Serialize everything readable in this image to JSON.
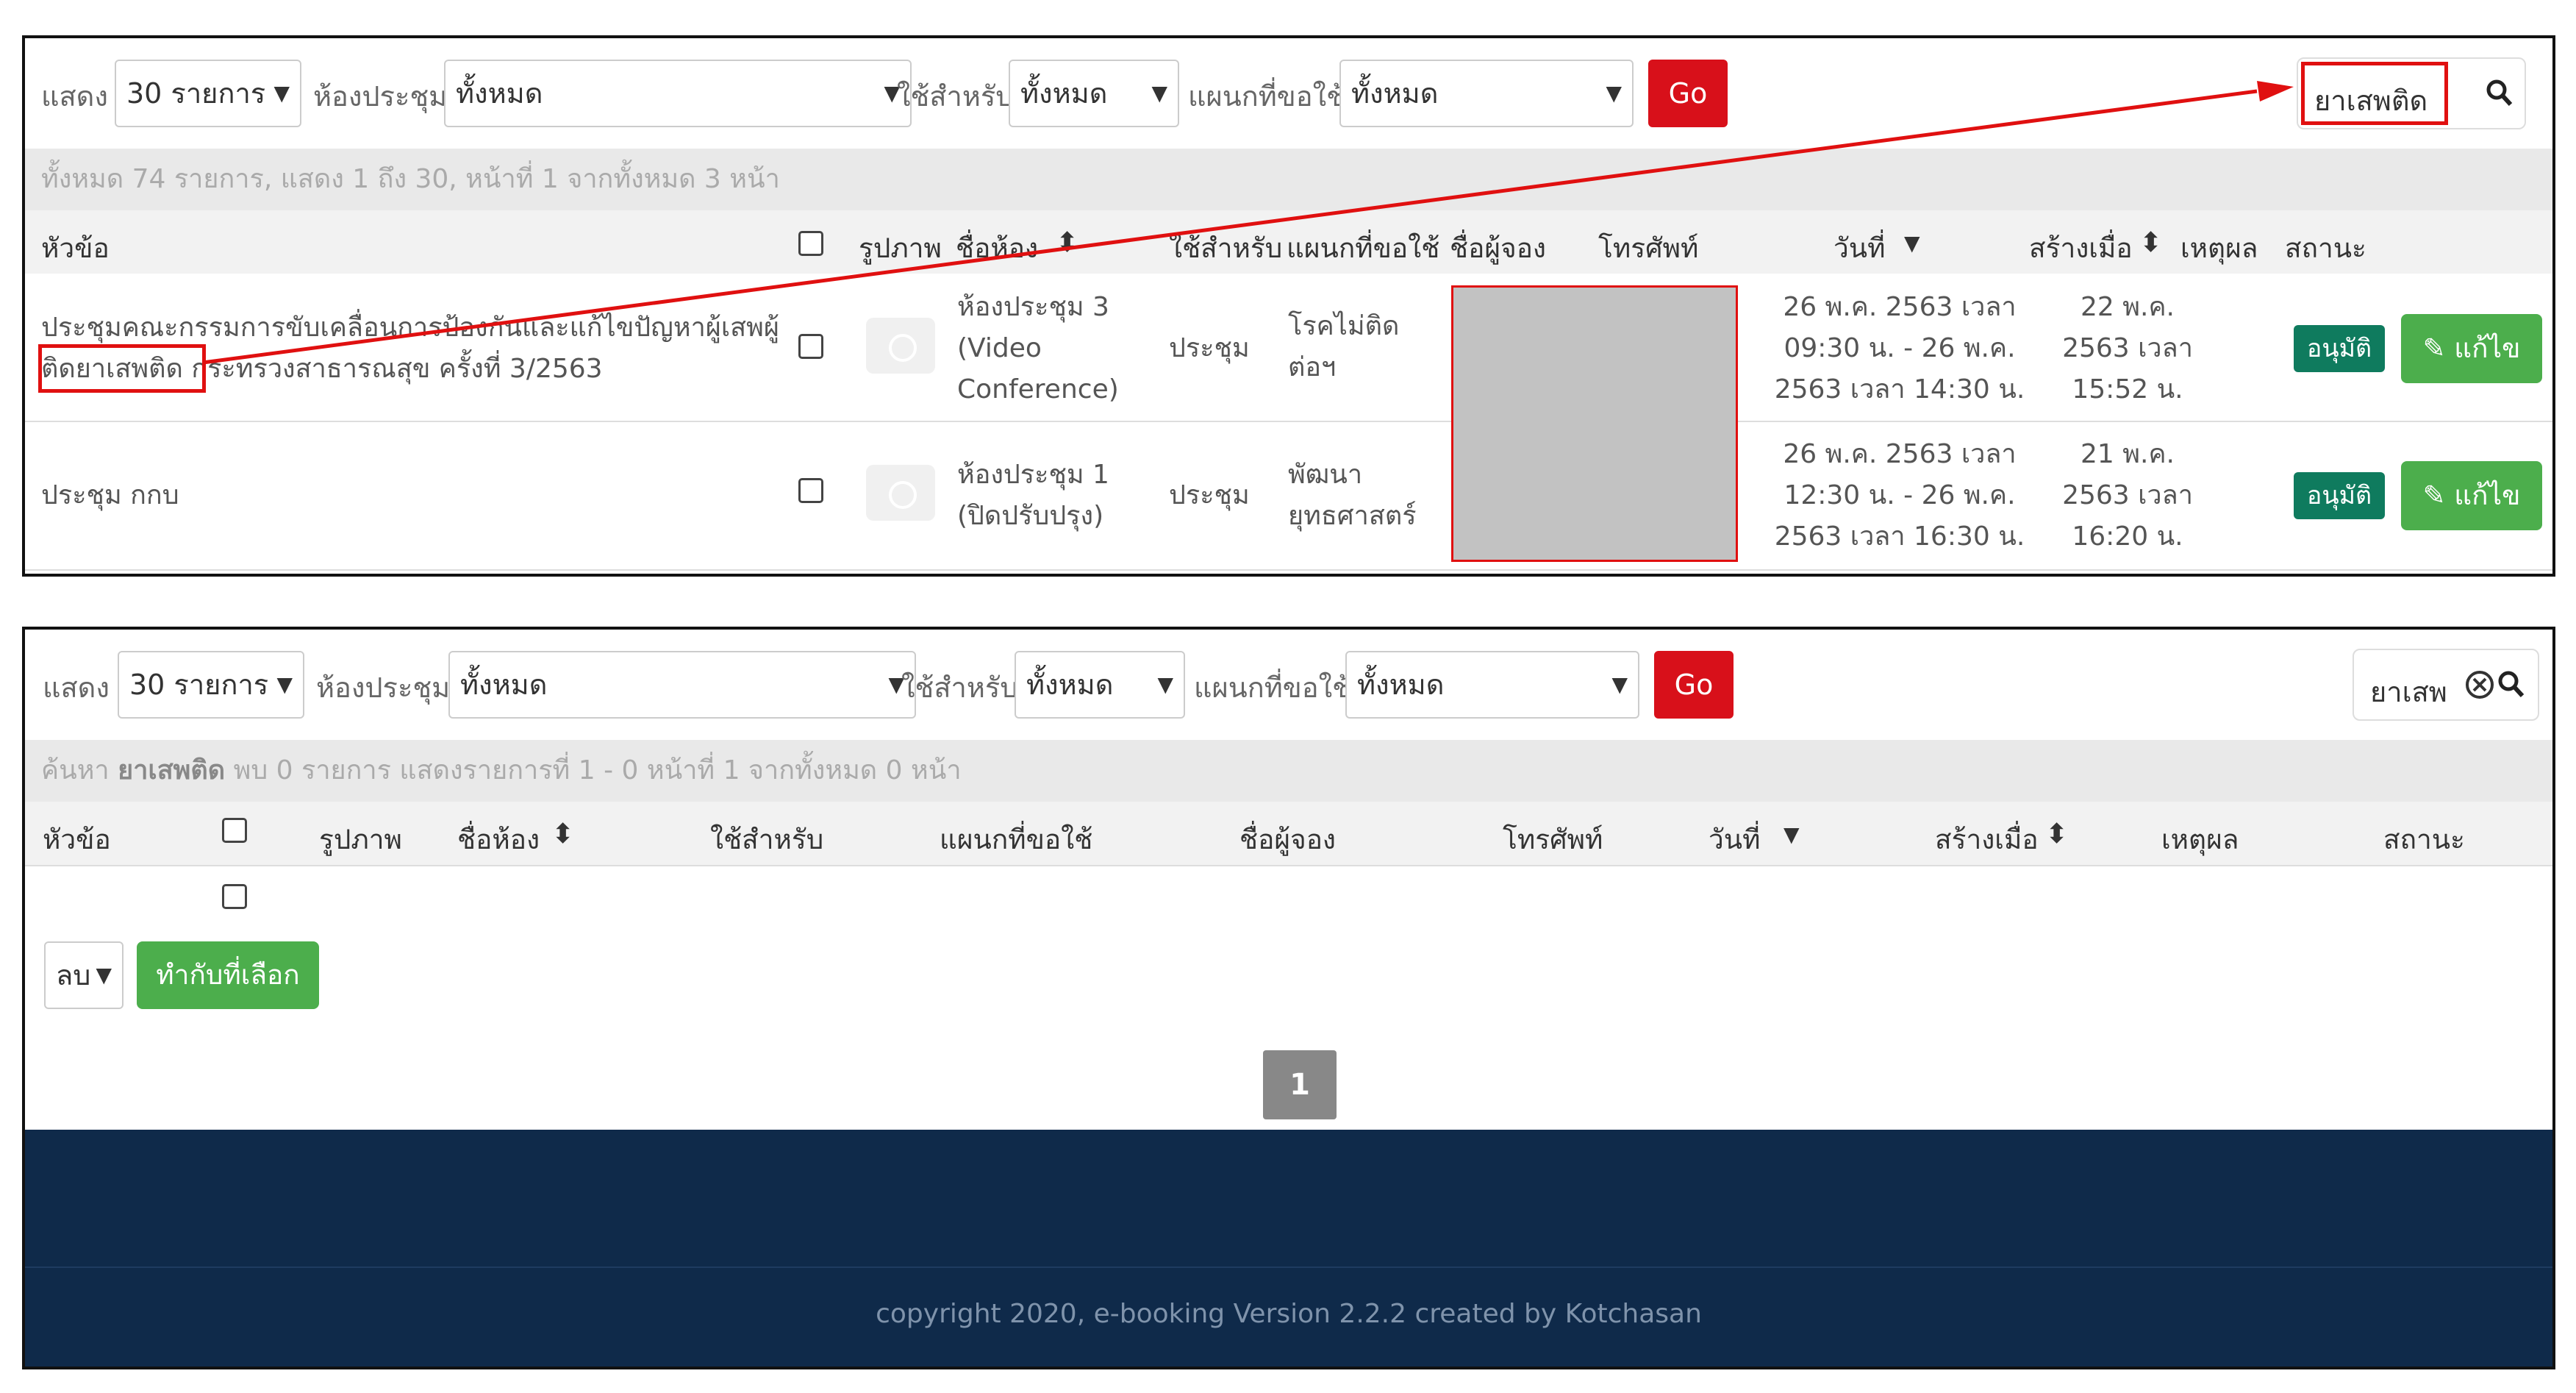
{
  "top_panel": {
    "toolbar": {
      "show_label": "แสดง",
      "show_value": "30 รายการ",
      "room_label": "ห้องประชุม",
      "room_value": "ทั้งหมด",
      "use_label": "ใช้สำหรับ",
      "use_value": "ทั้งหมด",
      "dept_label": "แผนกที่ขอใช้",
      "dept_value": "ทั้งหมด",
      "go_label": "Go",
      "search_value": "ยาเสพติด"
    },
    "info": "ทั้งหมด 74 รายการ, แสดง 1 ถึง 30, หน้าที่ 1 จากทั้งหมด 3 หน้า",
    "headers": {
      "topic": "หัวข้อ",
      "image": "รูปภาพ",
      "room": "ชื่อห้อง",
      "use": "ใช้สำหรับ",
      "dept": "แผนกที่ขอใช้",
      "booker": "ชื่อผู้จอง",
      "phone": "โทรศัพท์",
      "date": "วันที่",
      "created": "สร้างเมื่อ",
      "reason": "เหตุผล",
      "status": "สถานะ"
    },
    "rows": [
      {
        "topic_line1": "ประชุมคณะกรรมการขับเคลื่อนการป้องกันและแก้ไขปัญหาผู้เสพผู้",
        "topic_line2_highlight": "ติดยาเสพติด",
        "topic_line2_rest": " กระทรวงสาธารณสุข ครั้งที่ 3/2563",
        "room_line1": "ห้องประชุม 3",
        "room_line2": "(Video",
        "room_line3": "Conference)",
        "use": "ประชุม",
        "dept_line1": "โรคไม่ติด",
        "dept_line2": "ต่อฯ",
        "date_line1": "26 พ.ค. 2563 เวลา",
        "date_line2": "09:30 น. - 26 พ.ค.",
        "date_line3": "2563 เวลา 14:30 น.",
        "created_line1": "22 พ.ค.",
        "created_line2": "2563 เวลา",
        "created_line3": "15:52 น.",
        "status": "อนุมัติ",
        "edit_label": "แก้ไข"
      },
      {
        "topic_line1": "ประชุม กกบ",
        "room_line1": "ห้องประชุม 1",
        "room_line2": "(ปิดปรับปรุง)",
        "use": "ประชุม",
        "dept_line1": "พัฒนา",
        "dept_line2": "ยุทธศาสตร์",
        "date_line1": "26 พ.ค. 2563 เวลา",
        "date_line2": "12:30 น. - 26 พ.ค.",
        "date_line3": "2563 เวลา 16:30 น.",
        "created_line1": "21 พ.ค.",
        "created_line2": "2563 เวลา",
        "created_line3": "16:20 น.",
        "status": "อนุมัติ",
        "edit_label": "แก้ไข"
      }
    ]
  },
  "bottom_panel": {
    "toolbar": {
      "show_label": "แสดง",
      "show_value": "30 รายการ",
      "room_label": "ห้องประชุม",
      "room_value": "ทั้งหมด",
      "use_label": "ใช้สำหรับ",
      "use_value": "ทั้งหมด",
      "dept_label": "แผนกที่ขอใช้",
      "dept_value": "ทั้งหมด",
      "go_label": "Go",
      "search_value": "ยาเสพ"
    },
    "info_prefix": "ค้นหา ",
    "info_keyword": "ยาเสพติด",
    "info_suffix": " พบ 0 รายการ แสดงรายการที่ 1 - 0 หน้าที่ 1 จากทั้งหมด 0 หน้า",
    "headers": {
      "topic": "หัวข้อ",
      "image": "รูปภาพ",
      "room": "ชื่อห้อง",
      "use": "ใช้สำหรับ",
      "dept": "แผนกที่ขอใช้",
      "booker": "ชื่อผู้จอง",
      "phone": "โทรศัพท์",
      "date": "วันที่",
      "created": "สร้างเมื่อ",
      "reason": "เหตุผล",
      "status": "สถานะ"
    },
    "bulk_action_value": "ลบ",
    "bulk_apply_label": "ทำกับที่เลือก",
    "page_number": "1",
    "footer_text": "copyright 2020, e-booking Version 2.2.2 created by Kotchasan"
  },
  "colors": {
    "go_red": "#d8101a",
    "approve_green": "#0f7b5e",
    "edit_green": "#4cae4c",
    "footer_navy": "#0f2a4a",
    "annotation_red": "#e01010"
  },
  "icons": [
    "search-icon",
    "clear-icon",
    "sort-icon",
    "sort-down-icon",
    "camera-icon",
    "pencil-icon",
    "chevron-down-icon"
  ]
}
